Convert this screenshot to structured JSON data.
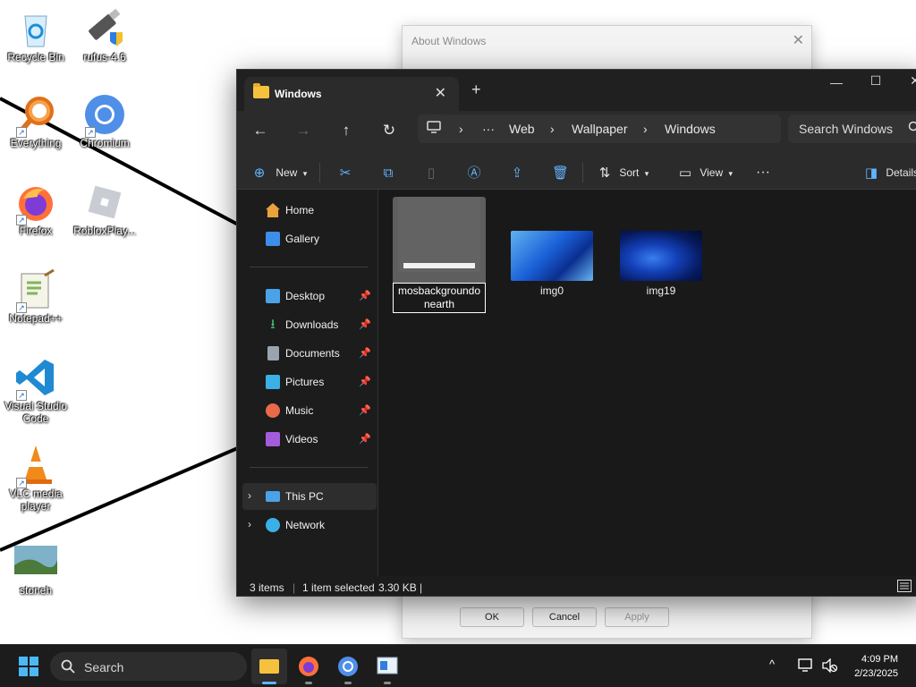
{
  "desktop": {
    "icons": [
      {
        "label": "Recycle Bin"
      },
      {
        "label": "rufus-4.6"
      },
      {
        "label": "Everything"
      },
      {
        "label": "Chromium"
      },
      {
        "label": "Firefox"
      },
      {
        "label": "RobloxPlay..."
      },
      {
        "label": "Notepad++"
      },
      {
        "label": "Visual Studio Code"
      },
      {
        "label": "VLC media player"
      },
      {
        "label": "stoneh"
      }
    ]
  },
  "about_dialog": {
    "title": "About Windows",
    "close": "✕",
    "ok_label": "OK",
    "cancel_label": "Cancel",
    "apply_label": "Apply"
  },
  "explorer": {
    "tab_title": "Windows",
    "tab_close": "✕",
    "new_tab": "+",
    "window_controls": {
      "minimize": "—",
      "maximize": "☐",
      "close": "✕"
    },
    "nav": {
      "back": "←",
      "forward": "→",
      "up": "↑",
      "refresh": "↻"
    },
    "breadcrumb": {
      "more": "···",
      "sep": "›",
      "items": [
        "Web",
        "Wallpaper",
        "Windows"
      ]
    },
    "search_placeholder": "Search Windows",
    "toolbar": {
      "new_label": "New",
      "sort_label": "Sort",
      "view_label": "View",
      "more": "···",
      "details_label": "Details"
    },
    "sidebar": {
      "top": [
        {
          "label": "Home",
          "color": "#e8a33d"
        },
        {
          "label": "Gallery",
          "color": "#3d8ee8"
        }
      ],
      "pinned": [
        {
          "label": "Desktop",
          "color": "#4aa3e8"
        },
        {
          "label": "Downloads",
          "color": "#3ec27a"
        },
        {
          "label": "Documents",
          "color": "#9aa4b1"
        },
        {
          "label": "Pictures",
          "color": "#3ab0e6"
        },
        {
          "label": "Music",
          "color": "#e86a4a"
        },
        {
          "label": "Videos",
          "color": "#a35cdc"
        }
      ],
      "pin_glyph": "📌",
      "bottom": [
        {
          "label": "This PC",
          "color": "#4aa3e8"
        },
        {
          "label": "Network",
          "color": "#3ab0e6"
        }
      ],
      "chevron": "›"
    },
    "files": [
      {
        "name": "mosbackgroundonearth",
        "renaming": true
      },
      {
        "name": "img0",
        "renaming": false
      },
      {
        "name": "img19",
        "renaming": false
      }
    ],
    "status": {
      "items": "3 items",
      "selected": "1 item selected",
      "size": "3.30 KB"
    }
  },
  "taskbar": {
    "search_label": "Search",
    "time": "4:09 PM",
    "date": "2/23/2025",
    "tray_chevron": "^"
  },
  "colors": {
    "accent": "#62b4ff",
    "explorer_bg": "#191919",
    "taskbar_bg": "#1c1c1c"
  }
}
